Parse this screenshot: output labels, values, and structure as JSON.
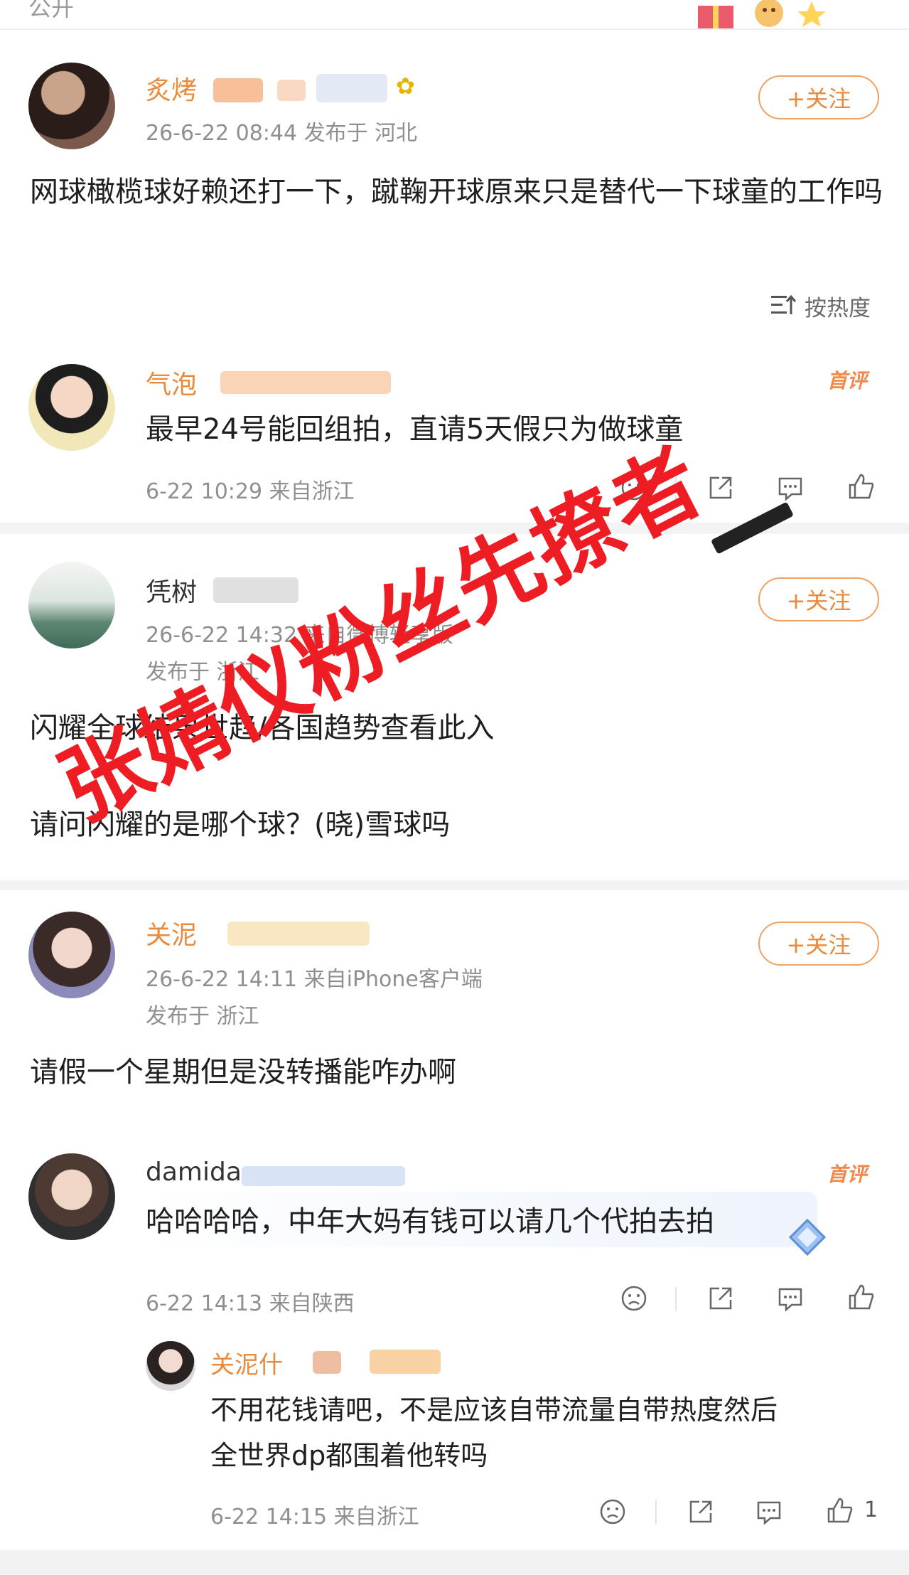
{
  "top": {
    "label": "公开"
  },
  "post1": {
    "username": "炙烤",
    "meta": "26-6-22 08:44  发布于 河北",
    "follow": "+关注",
    "text": "网球橄榄球好赖还打一下，蹴鞠开球原来只是替代一下球童的工作吗"
  },
  "sort": {
    "label": "按热度",
    "icon": "sort-lines-icon"
  },
  "comment1": {
    "username": "气泡",
    "badge": "首评",
    "text": "最早24号能回组拍，直请5天假只为做球童",
    "meta": "6-22 10:29 来自浙江"
  },
  "post2": {
    "username": "凭树",
    "meta_line1": "26-6-22 14:32  来自微博轻享版",
    "meta_line2": "发布于 浙江",
    "follow": "+关注",
    "text1": "闪耀全球结果世趋/各国趋势查看此入",
    "text2": "请问闪耀的是哪个球？(晓)雪球吗"
  },
  "post3": {
    "username": "关泥",
    "meta_line1": "26-6-22 14:11  来自iPhone客户端",
    "meta_line2": "发布于 浙江",
    "follow": "+关注",
    "text": "请假一个星期但是没转播能咋办啊"
  },
  "comment2": {
    "username": "damida",
    "badge": "首评",
    "text": "哈哈哈哈，中年大妈有钱可以请几个代拍去拍",
    "meta": "6-22 14:13 来自陕西"
  },
  "reply1": {
    "username": "关泥什",
    "text1": "不用花钱请吧，不是应该自带流量自带热度然后",
    "text2": "全世界dp都围着他转吗",
    "meta": "6-22 14:15 来自浙江",
    "like_count": "1"
  },
  "watermark": {
    "text": "张婧仪粉丝先撩者"
  },
  "colors": {
    "accent": "#e98a3c",
    "watermark": "#ee1d23",
    "meta": "#8f8f8f"
  }
}
